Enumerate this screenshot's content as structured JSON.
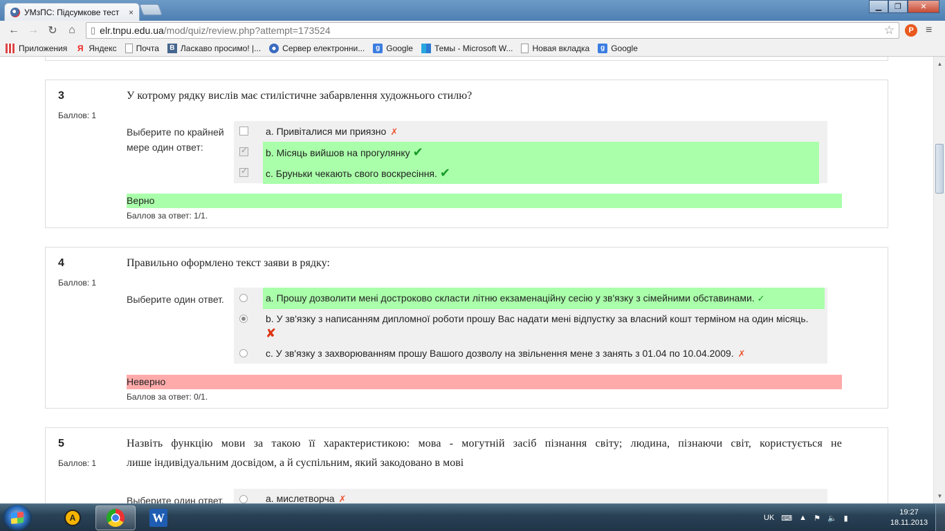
{
  "browser": {
    "tab_title": "УМзПС: Підсумкове тест",
    "tab_close": "×",
    "window_buttons": {
      "minimize": "▁",
      "maximize": "❐",
      "close": "✕"
    },
    "nav": {
      "back": "←",
      "forward": "→",
      "reload": "↻",
      "home": "⌂"
    },
    "url_host": "elr.tnpu.edu.ua",
    "url_path": "/mod/quiz/review.php?attempt=173524",
    "star": "☆",
    "ext_label": "P",
    "menu": "≡",
    "bookmarks": [
      {
        "label": "Приложения",
        "icon": "apps-icon"
      },
      {
        "label": "Яндекс",
        "icon": "yandex-icon",
        "glyph": "Я"
      },
      {
        "label": "Почта",
        "icon": "page-icon"
      },
      {
        "label": "Ласкаво просимо! |...",
        "icon": "vk-icon",
        "glyph": "B"
      },
      {
        "label": "Сервер електронни...",
        "icon": "ie-icon"
      },
      {
        "label": "Google",
        "icon": "google-icon",
        "glyph": "g"
      },
      {
        "label": "Темы - Microsoft W...",
        "icon": "windows-icon"
      },
      {
        "label": "Новая вкладка",
        "icon": "page-icon"
      },
      {
        "label": "Google",
        "icon": "google-icon",
        "glyph": "g"
      }
    ]
  },
  "quiz": {
    "q3": {
      "number": "3",
      "grade": "Баллов: 1",
      "text": "У котрому рядку вислів має стилістичне забарвлення художнього стилю?",
      "prompt": "Выберите по крайней мере один ответ:",
      "options": [
        {
          "text": "a. Привіталися ми приязно",
          "mark": "✗",
          "checked": false,
          "correct": false
        },
        {
          "text": "b. Місяць вийшов на прогулянку",
          "mark": "✔",
          "checked": true,
          "correct": true
        },
        {
          "text": "c. Бруньки чекають свого воскресіння.",
          "mark": "✔",
          "checked": true,
          "correct": true
        }
      ],
      "state": "Верно",
      "score": "Баллов за ответ: 1/1."
    },
    "q4": {
      "number": "4",
      "grade": "Баллов: 1",
      "text": "Правильно оформлено текст заяви в рядку:",
      "prompt": "Выберите один ответ.",
      "options": [
        {
          "text": "a. Прошу дозволити мені достроково скласти літню екзаменаційну сесію у зв'язку з сімейними обставинами.",
          "mark": "✓",
          "checked": false,
          "correct": true
        },
        {
          "text": "b. У зв'язку з написанням дипломної роботи прошу Вас надати мені відпустку за власний кошт терміном на один місяць.",
          "mark": "✘",
          "checked": true,
          "correct": false
        },
        {
          "text": "c. У зв'язку з захворюванням прошу Вашого дозволу на звільнення мене з занять з 01.04 по 10.04.2009.",
          "mark": "✗",
          "checked": false,
          "correct": false
        }
      ],
      "state": "Неверно",
      "score": "Баллов за ответ: 0/1."
    },
    "q5": {
      "number": "5",
      "grade": "Баллов: 1",
      "text_line1": "Назвіть функцію мови за такою її характеристикою: мова - могутній засіб пізнання світу; людина, пізнаючи світ, користується не",
      "text_line2": "лише індивідуальним досвідом, а й суспільним, який закодовано в мові",
      "prompt": "Выберите один ответ.",
      "options": [
        {
          "text": "a. мислетворча",
          "mark": "✗",
          "checked": false
        }
      ]
    }
  },
  "scrollbar": {
    "up": "▲",
    "down": "▼"
  },
  "taskbar": {
    "tray_lang": "UK",
    "tray_icons": [
      "⌨",
      "▲",
      "⚑",
      "🔈",
      "▮"
    ],
    "time": "19:27",
    "date": "18.11.2013",
    "avast_glyph": "A",
    "word_glyph": "W"
  }
}
